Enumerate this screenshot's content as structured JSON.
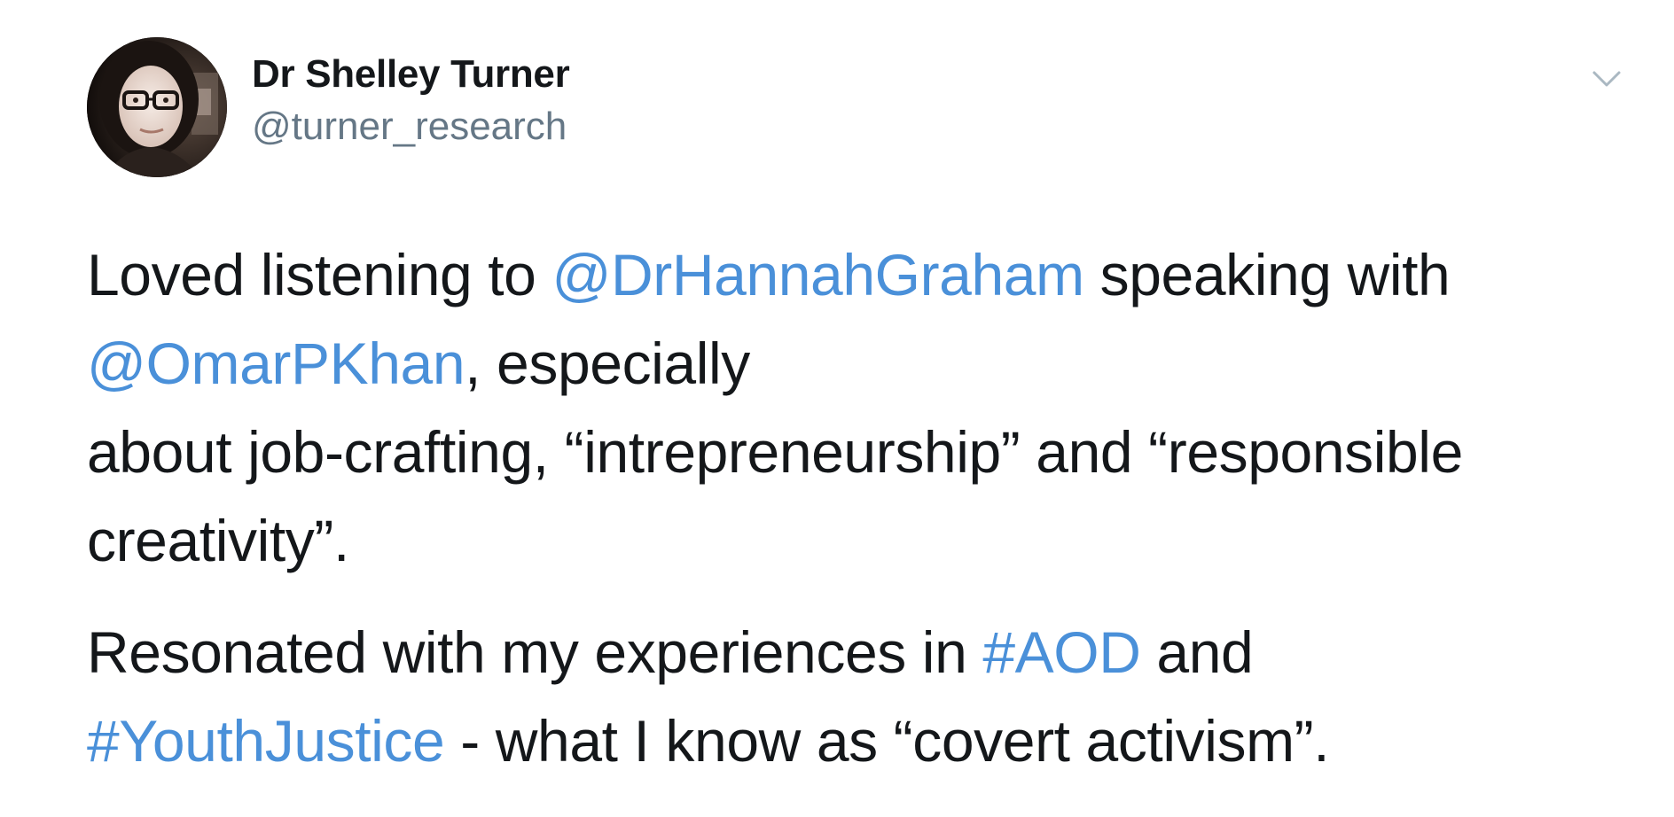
{
  "tweet": {
    "author": {
      "display_name": "Dr Shelley Turner",
      "handle": "@turner_research",
      "avatar_icon": "profile-photo",
      "menu_icon": "chevron-down-icon"
    },
    "paragraph1": {
      "t1": "Loved listening to ",
      "mention1": "@DrHannahGraham",
      "t2": " speaking with",
      "mention2": "@OmarPKhan",
      "t3": ", especially",
      "t4": "about job-crafting, “intrepreneurship” and “responsible",
      "t5": "creativity”."
    },
    "paragraph2": {
      "t1": "Resonated with my experiences in ",
      "hashtag1": "#AOD",
      "t2": " and",
      "hashtag2": "#YouthJustice",
      "t3": " - what I know as “covert activism”."
    },
    "colors": {
      "link": "#4a90d9",
      "text": "#14171a",
      "handle": "#657786"
    }
  }
}
